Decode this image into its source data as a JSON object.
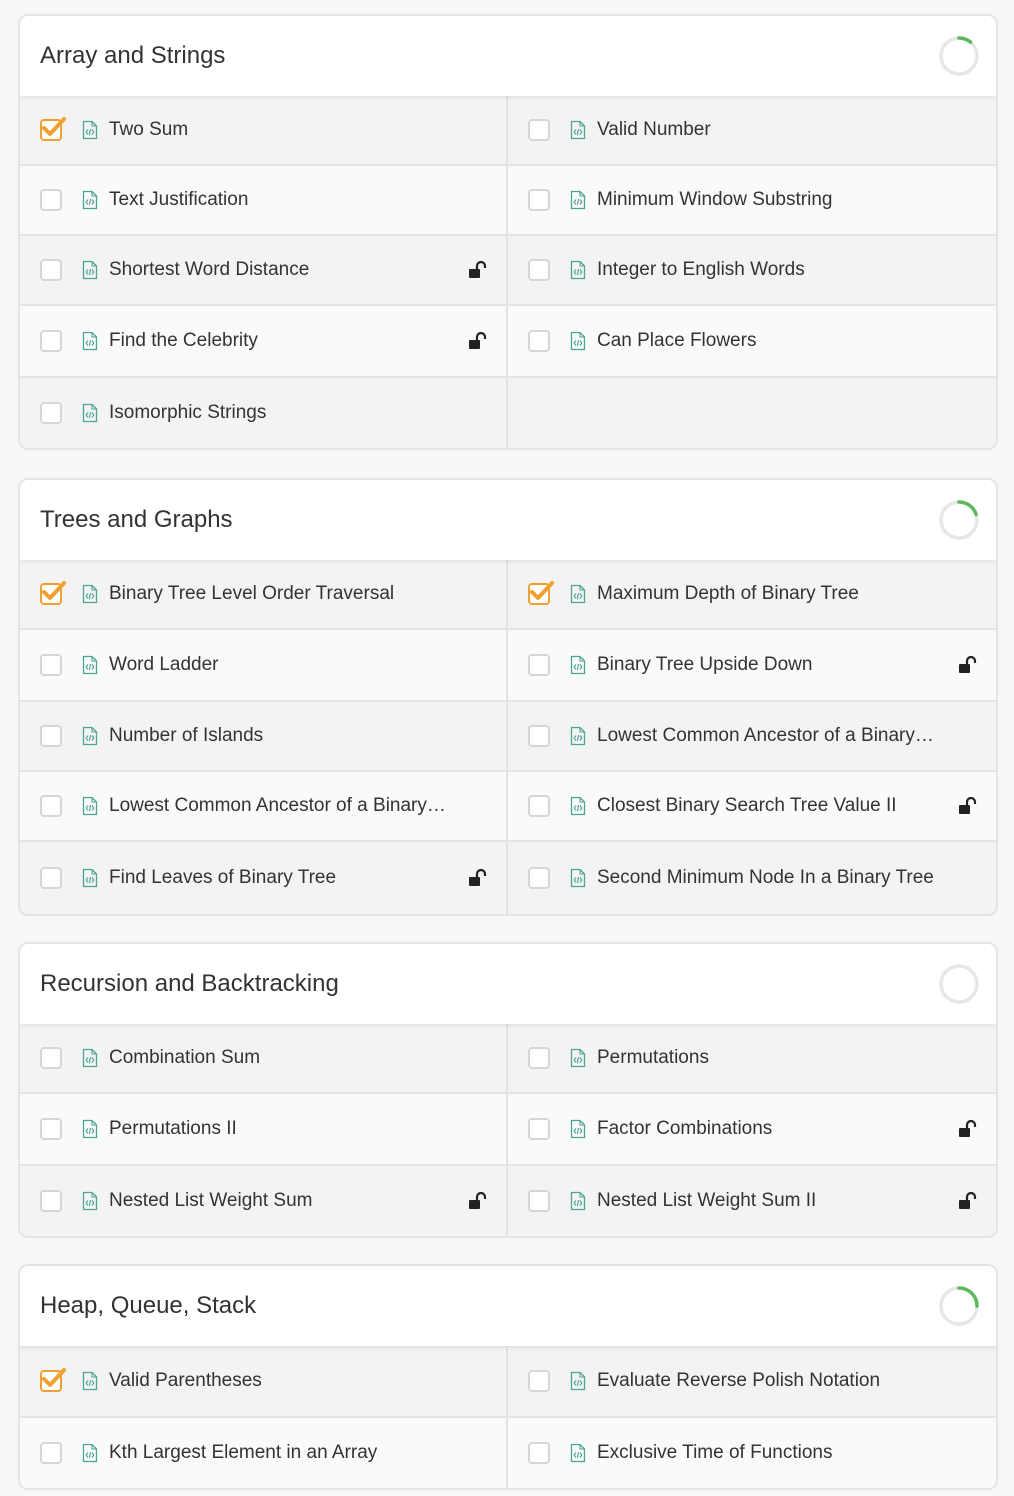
{
  "colors": {
    "accent": "#f0a030",
    "progress": "#5cb85c",
    "icon": "#4aa592"
  },
  "sections": [
    {
      "title": "Array and Strings",
      "progress": 0.11,
      "problems": [
        {
          "name": "Two Sum",
          "checked": true,
          "locked": false
        },
        {
          "name": "Valid Number",
          "checked": false,
          "locked": false
        },
        {
          "name": "Text Justification",
          "checked": false,
          "locked": false
        },
        {
          "name": "Minimum Window Substring",
          "checked": false,
          "locked": false
        },
        {
          "name": "Shortest Word Distance",
          "checked": false,
          "locked": true
        },
        {
          "name": "Integer to English Words",
          "checked": false,
          "locked": false
        },
        {
          "name": "Find the Celebrity",
          "checked": false,
          "locked": true
        },
        {
          "name": "Can Place Flowers",
          "checked": false,
          "locked": false
        },
        {
          "name": "Isomorphic Strings",
          "checked": false,
          "locked": false
        }
      ]
    },
    {
      "title": "Trees and Graphs",
      "progress": 0.2,
      "problems": [
        {
          "name": "Binary Tree Level Order Traversal",
          "checked": true,
          "locked": false
        },
        {
          "name": "Maximum Depth of Binary Tree",
          "checked": true,
          "locked": false
        },
        {
          "name": "Word Ladder",
          "checked": false,
          "locked": false
        },
        {
          "name": "Binary Tree Upside Down",
          "checked": false,
          "locked": true
        },
        {
          "name": "Number of Islands",
          "checked": false,
          "locked": false
        },
        {
          "name": "Lowest Common Ancestor of a Binary…",
          "checked": false,
          "locked": false
        },
        {
          "name": "Lowest Common Ancestor of a Binary…",
          "checked": false,
          "locked": false
        },
        {
          "name": "Closest Binary Search Tree Value II",
          "checked": false,
          "locked": true
        },
        {
          "name": "Find Leaves of Binary Tree",
          "checked": false,
          "locked": true
        },
        {
          "name": "Second Minimum Node In a Binary Tree",
          "checked": false,
          "locked": false
        }
      ]
    },
    {
      "title": "Recursion and Backtracking",
      "progress": 0,
      "problems": [
        {
          "name": "Combination Sum",
          "checked": false,
          "locked": false
        },
        {
          "name": "Permutations",
          "checked": false,
          "locked": false
        },
        {
          "name": "Permutations II",
          "checked": false,
          "locked": false
        },
        {
          "name": "Factor Combinations",
          "checked": false,
          "locked": true
        },
        {
          "name": "Nested List Weight Sum",
          "checked": false,
          "locked": true
        },
        {
          "name": "Nested List Weight Sum II",
          "checked": false,
          "locked": true
        }
      ]
    },
    {
      "title": "Heap, Queue, Stack",
      "progress": 0.25,
      "problems": [
        {
          "name": "Valid Parentheses",
          "checked": true,
          "locked": false
        },
        {
          "name": "Evaluate Reverse Polish Notation",
          "checked": false,
          "locked": false
        },
        {
          "name": "Kth Largest Element in an Array",
          "checked": false,
          "locked": false
        },
        {
          "name": "Exclusive Time of Functions",
          "checked": false,
          "locked": false
        }
      ]
    }
  ]
}
